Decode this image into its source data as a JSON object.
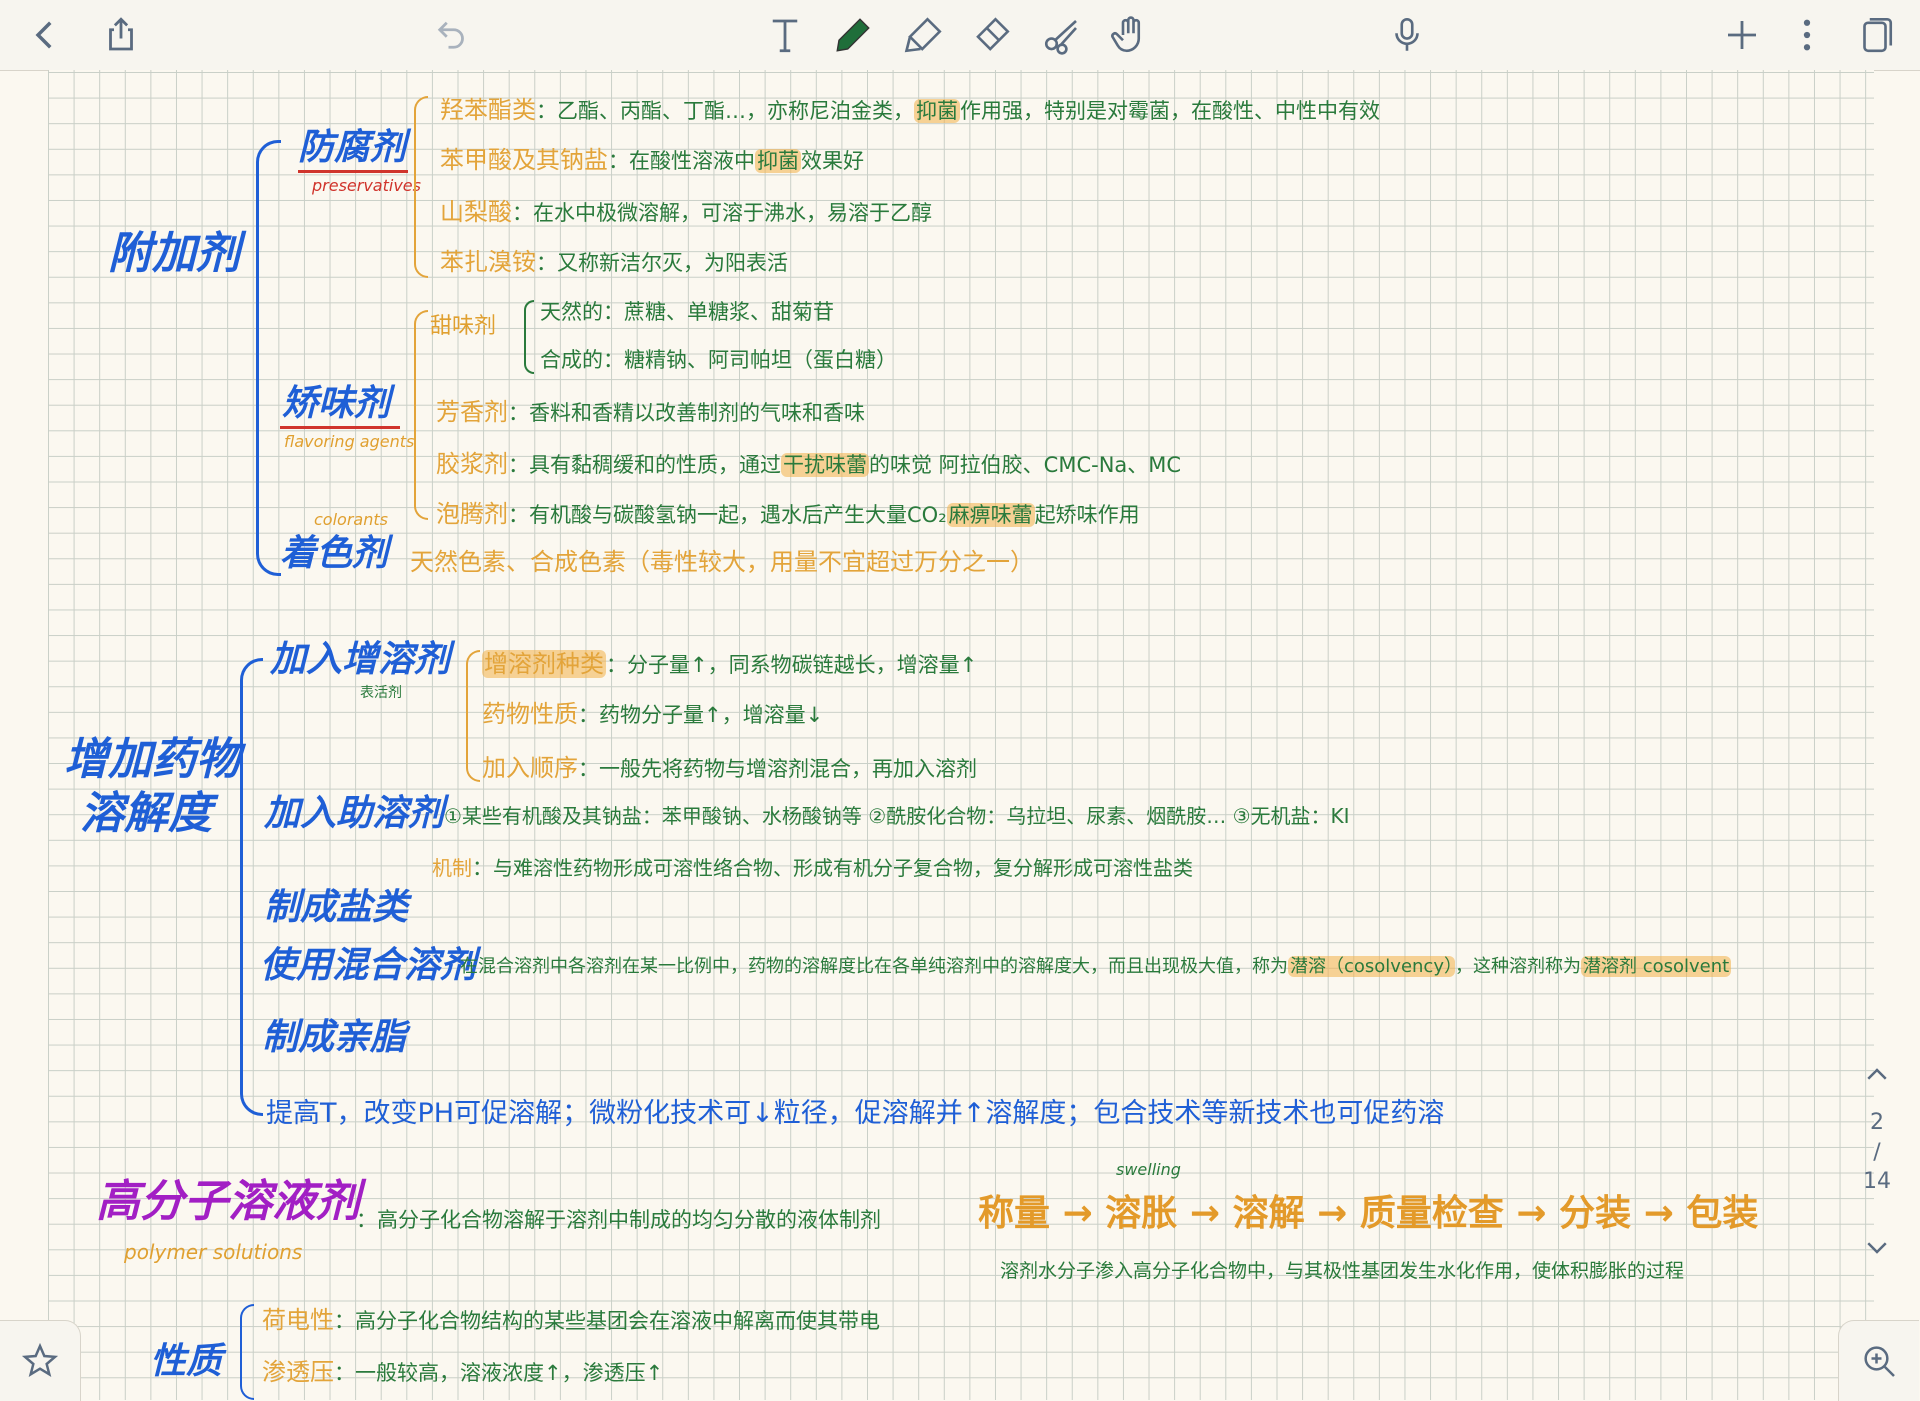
{
  "toolbar": {
    "left": [
      "back-icon",
      "share-icon",
      "undo-icon"
    ],
    "center": [
      "text-tool-icon",
      "pen-tool-icon",
      "highlighter-icon",
      "eraser-icon",
      "lasso-icon",
      "hand-icon"
    ],
    "right": [
      "microphone-icon",
      "add-icon",
      "more-icon",
      "pages-icon"
    ],
    "accent": "#5a6b80"
  },
  "pager": {
    "current": "2",
    "sep": "/",
    "total": "14"
  },
  "notes": {
    "additives": "附加剂",
    "preservatives": {
      "title": "防腐剂",
      "en": "preservatives",
      "items": [
        {
          "label": "羟苯酯类",
          "text": "乙酯、丙酯、丁酯…，亦称尼泊金类",
          "hl": "抑菌",
          "text2": "作用强，特别是对霉菌，在酸性、中性中有效"
        },
        {
          "label": "苯甲酸及其钠盐",
          "text": "在酸性溶液中",
          "hl": "抑菌",
          "text2": "效果好"
        },
        {
          "label": "山梨酸",
          "text": "在水中极微溶解，可溶于沸水，易溶于乙醇"
        },
        {
          "label": "苯扎溴铵",
          "text": "又称新洁尔灭，为阳表活"
        }
      ]
    },
    "flavoring": {
      "title": "矫味剂",
      "en": "flavoring agents",
      "sweetener": "甜味剂",
      "sweet_natural": "天然的：蔗糖、单糖浆、甜菊苷",
      "sweet_synthetic": "合成的：糖精钠、阿司帕坦（蛋白糖）",
      "items": [
        {
          "label": "芳香剂",
          "text": "香料和香精以改善制剂的气味和香味"
        },
        {
          "label": "胶浆剂",
          "text": "具有黏稠缓和的性质，通过",
          "hl": "干扰味蕾",
          "text2": "的味觉 阿拉伯胶、CMC-Na、MC"
        },
        {
          "label": "泡腾剂",
          "text": "有机酸与碳酸氢钠一起，遇水后产生大量CO₂",
          "hl": "麻痹味蕾",
          "text2": "起矫味作用"
        }
      ]
    },
    "colorants": {
      "title": "着色剂",
      "en": "colorants",
      "text": "天然色素、合成色素（毒性较大，用量不宜超过万分之一）"
    },
    "solubility": {
      "title_line1": "增加药物",
      "title_line2": "溶解度",
      "solubilizer": {
        "title": "加入增溶剂",
        "sub": "表活剂",
        "items": [
          {
            "label": "增溶剂种类",
            "text": "分子量↑，同系物碳链越长，增溶量↑"
          },
          {
            "label": "药物性质",
            "text": "药物分子量↑，增溶量↓"
          },
          {
            "label": "加入顺序",
            "text": "一般先将药物与增溶剂混合，再加入溶剂"
          }
        ]
      },
      "cosolubilizer": {
        "title": "加入助溶剂",
        "text": "①某些有机酸及其钠盐：苯甲酸钠、水杨酸钠等 ②酰胺化合物：乌拉坦、尿素、烟酰胺… ③无机盐：KI",
        "label": "机制",
        "text2": "与难溶性药物形成可溶性络合物、形成有机分子复合物，复分解形成可溶性盐类"
      },
      "salt": "制成盐类",
      "mixed": {
        "title": "使用混合溶剂",
        "text": "在混合溶剂中各溶剂在某一比例中，药物的溶解度比在各单纯溶剂中的溶解度大，而且出现极大值，称为",
        "hl1": "潜溶（cosolvency）",
        "mid": "这种溶剂称为",
        "hl2": "潜溶剂 cosolvent"
      },
      "ester": "制成亲脂",
      "footer": "提高T，改变PH可促溶解；微粉化技术可↓粒径，促溶解并↑溶解度；包合技术等新技术也可促药溶"
    },
    "polymer": {
      "title": "高分子溶液剂",
      "en": "polymer solutions",
      "def": "高分子化合物溶解于溶剂中制成的均匀分散的液体制剂",
      "flow": [
        "称量",
        "→",
        "溶胀",
        "→",
        "溶解",
        "→",
        "质量检查",
        "→",
        "分装",
        "→",
        "包装"
      ],
      "swelling": "swelling",
      "swell_note": "溶剂水分子渗入高分子化合物中，与其极性基团发生水化作用，使体积膨胀的过程"
    },
    "properties": {
      "title": "性质",
      "items": [
        {
          "label": "荷电性",
          "text": "高分子化合物结构的某些基团会在溶液中解离而使其带电"
        },
        {
          "label": "渗透压",
          "text": "一般较高，溶液浓度↑，渗透压↑"
        }
      ]
    }
  }
}
